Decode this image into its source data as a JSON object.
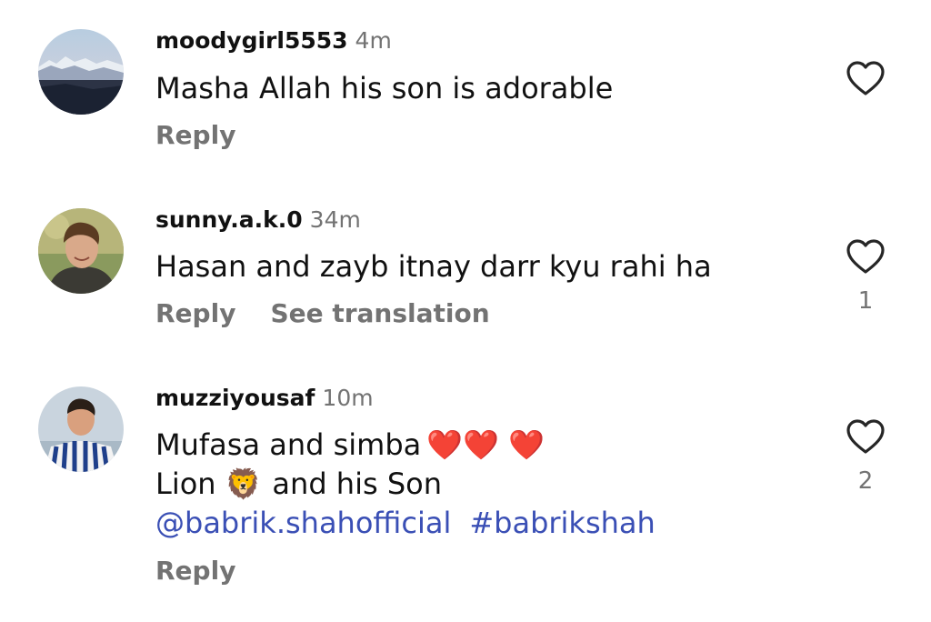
{
  "comments": [
    {
      "username": "moodygirl5553",
      "time": "4m",
      "lines": [
        "Masha Allah his son is adorable"
      ],
      "reply_label": "Reply",
      "likes": ""
    },
    {
      "username": "sunny.a.k.0",
      "time": "34m",
      "lines": [
        "Hasan and zayb itnay darr kyu rahi ha"
      ],
      "reply_label": "Reply",
      "translate_label": "See translation",
      "likes": "1"
    },
    {
      "username": "muzziyousaf",
      "time": "10m",
      "line1_text": "Mufasa and simba",
      "line1_emoji": "❤️❤️ ❤️",
      "line2_pre": "Lion",
      "line2_emoji": "🦁",
      "line2_post": "and his Son",
      "mention": "@babrik.shahofficial",
      "hashtag": "#babrikshah",
      "reply_label": "Reply",
      "likes": "2"
    }
  ],
  "colors": {
    "text": "#111111",
    "muted": "#737373",
    "link": "#3a4fb5",
    "heart_outline": "#262626"
  },
  "icons": {
    "avatar_1": "mountain-landscape-avatar",
    "avatar_2": "person-photo-avatar",
    "avatar_3": "person-striped-shirt-avatar",
    "like": "heart-outline-icon"
  }
}
